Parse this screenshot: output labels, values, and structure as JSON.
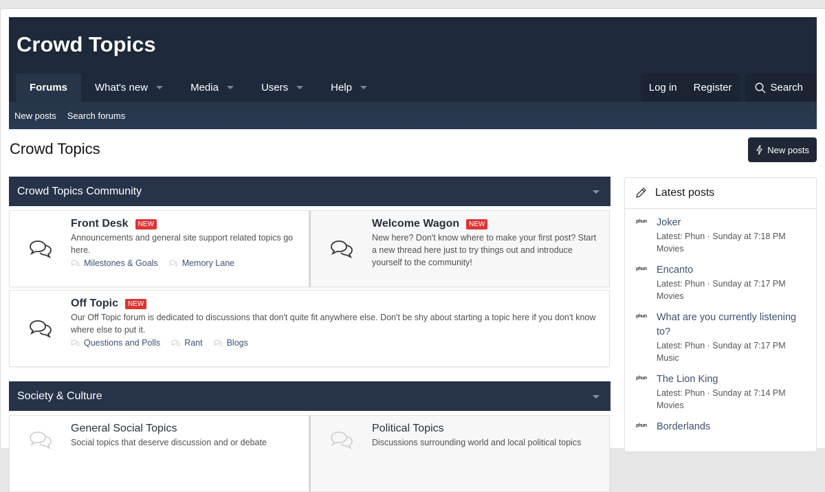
{
  "site": {
    "title": "Crowd Topics"
  },
  "nav": {
    "tabs": [
      {
        "label": "Forums",
        "active": true,
        "dropdown": false
      },
      {
        "label": "What's new",
        "dropdown": true
      },
      {
        "label": "Media",
        "dropdown": true
      },
      {
        "label": "Users",
        "dropdown": true
      },
      {
        "label": "Help",
        "dropdown": true
      }
    ],
    "login": "Log in",
    "register": "Register",
    "search": "Search",
    "sub": [
      "New posts",
      "Search forums"
    ]
  },
  "page": {
    "title": "Crowd Topics",
    "new_posts_button": "New posts"
  },
  "categories": [
    {
      "title": "Crowd Topics Community",
      "nodes": [
        {
          "title": "Front Desk",
          "badge": "NEW",
          "description": "Announcements and general site support related topics go here.",
          "subforums": [
            "Milestones & Goals",
            "Memory Lane"
          ]
        },
        {
          "title": "Welcome Wagon",
          "badge": "NEW",
          "description": "New here? Don't know where to make your first post? Start a new thread here just to try things out and introduce yourself to the community!"
        },
        {
          "title": "Off Topic",
          "badge": "NEW",
          "description": "Our Off Topic forum is dedicated to discussions that don't quite fit anywhere else. Don't be shy about starting a topic here if you don't know where else to put it.",
          "subforums": [
            "Questions and Polls",
            "Rant",
            "Blogs"
          ]
        }
      ]
    },
    {
      "title": "Society & Culture",
      "nodes": [
        {
          "title": "General Social Topics",
          "description": "Social topics that deserve discussion and or debate"
        },
        {
          "title": "Political Topics",
          "description": "Discussions surrounding world and local political topics"
        }
      ]
    }
  ],
  "sidebar": {
    "title": "Latest posts",
    "posts": [
      {
        "avatar": "phun",
        "title": "Joker",
        "meta": "Latest: Phun · Sunday at 7:18 PM",
        "forum": "Movies"
      },
      {
        "avatar": "phun",
        "title": "Encanto",
        "meta": "Latest: Phun · Sunday at 7:17 PM",
        "forum": "Movies"
      },
      {
        "avatar": "phun",
        "title": "What are you currently listening to?",
        "meta": "Latest: Phun · Sunday at 7:17 PM",
        "forum": "Music"
      },
      {
        "avatar": "phun",
        "title": "The Lion King",
        "meta": "Latest: Phun · Sunday at 7:14 PM",
        "forum": "Movies"
      },
      {
        "avatar": "phun",
        "title": "Borderlands",
        "meta": "",
        "forum": ""
      }
    ]
  }
}
